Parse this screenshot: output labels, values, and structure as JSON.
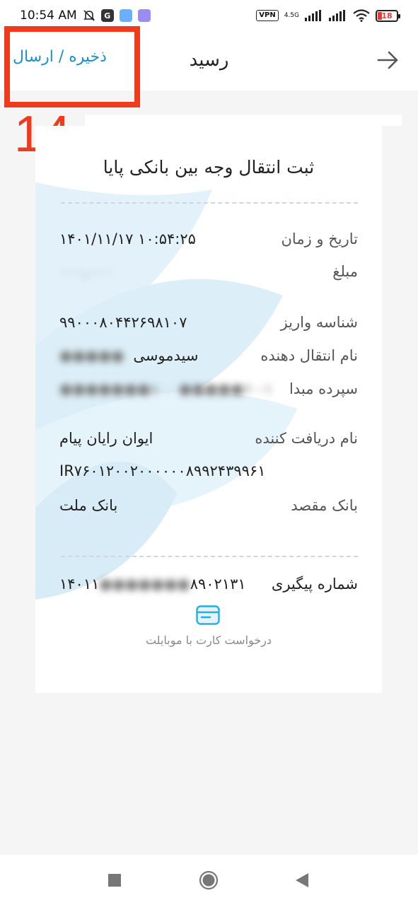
{
  "status_bar": {
    "time": "10:54 AM",
    "vpn": "VPN",
    "network_type": "4.5G",
    "battery": "18",
    "app_badges": [
      "G"
    ]
  },
  "header": {
    "title": "رسید",
    "save_send_label": "ذخیره / ارسال"
  },
  "annotation": {
    "step_number": "14"
  },
  "receipt": {
    "title": "ثبت انتقال وجه بین بانکی پایا",
    "rows": {
      "datetime": {
        "label": "تاریخ و زمان",
        "value": "۱۴۰۱/۱۱/۱۷ ۱۰:۵۴:۲۵"
      },
      "amount": {
        "label": "مبلغ",
        "value": "۰۰۰,۰۰۰"
      },
      "deposit_id": {
        "label": "شناسه واریز",
        "value": "۹۹۰۰۰۸۰۴۴۲۶۹۸۱۰۷"
      },
      "sender_name": {
        "label": "نام انتقال دهنده",
        "value": "سیدموسی",
        "value_blurred": "●●●●●"
      },
      "source_account": {
        "label": "سپرده مبدا",
        "value_blurred": "●●●●●●●۸۰۰",
        "value_tail": "●●●●●۶۰-۱"
      },
      "receiver_name": {
        "label": "نام دریافت کننده",
        "value": "ایوان رایان پیام"
      },
      "iban": {
        "value": "IR۷۶۰۱۲۰۰۲۰۰۰۰۰۰۸۹۹۲۴۳۹۹۶۱"
      },
      "dest_bank": {
        "label": "بانک مقصد",
        "value": "بانک ملت"
      },
      "tracking": {
        "label": "شماره پیگیری",
        "value_head": "۱۴۰۱۱",
        "value_blurred": "●●●●●●●",
        "value_tail": "۸۹۰۲۱۳۱"
      }
    },
    "card_request_text": "درخواست کارت با موبایلت"
  },
  "colors": {
    "accent": "#1a8fc9",
    "annotation_red": "#f03a1e",
    "watermark": "#d6ecf6"
  }
}
